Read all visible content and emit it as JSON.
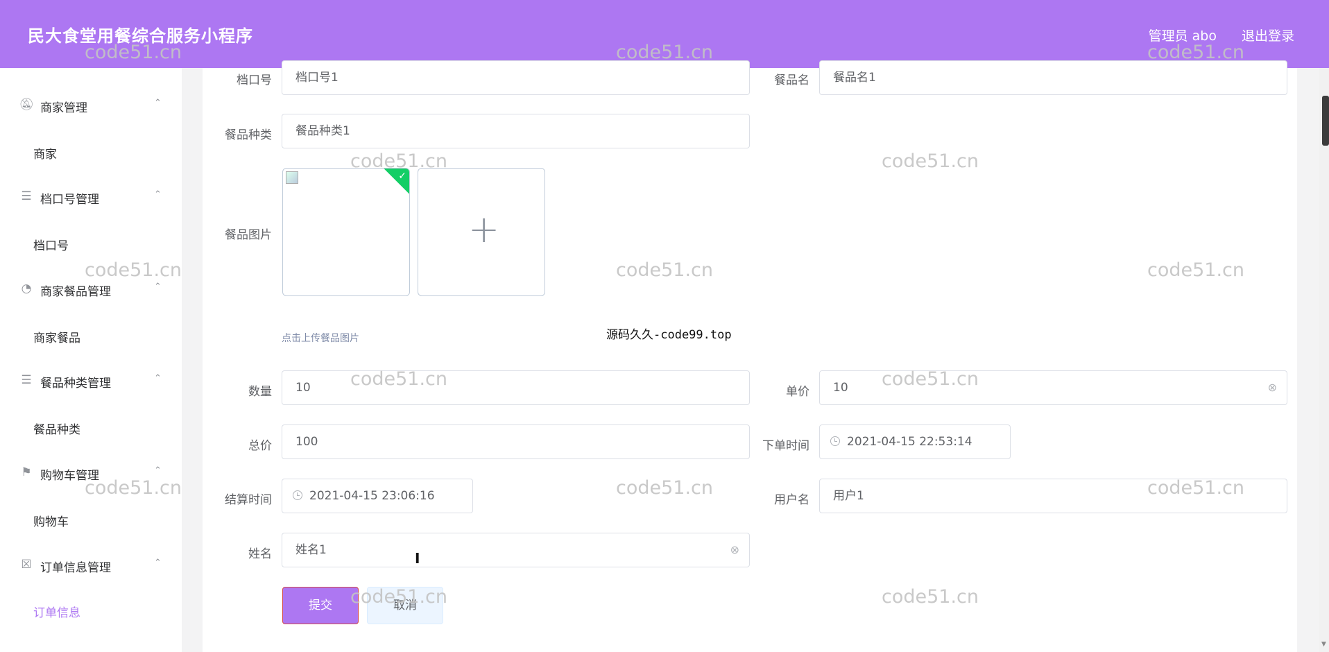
{
  "header": {
    "app_title": "民大食堂用餐综合服务小程序",
    "user_label": "管理员 abo",
    "logout_label": "退出登录"
  },
  "colors": {
    "accent": "#ad77f2",
    "success": "#13ce66",
    "border": "#dcdfe6"
  },
  "sidebar": {
    "groups": [
      {
        "icon": "bell-off-icon",
        "label": "商家管理",
        "items": [
          "商家"
        ]
      },
      {
        "icon": "list-icon",
        "label": "档口号管理",
        "items": [
          "档口号"
        ]
      },
      {
        "icon": "compass-icon",
        "label": "商家餐品管理",
        "items": [
          "商家餐品"
        ]
      },
      {
        "icon": "list-icon",
        "label": "餐品种类管理",
        "items": [
          "餐品种类"
        ]
      },
      {
        "icon": "flag-icon",
        "label": "购物车管理",
        "items": [
          "购物车"
        ]
      },
      {
        "icon": "clipboard-icon",
        "label": "订单信息管理",
        "items": [
          "订单信息"
        ]
      }
    ],
    "active_item": "订单信息"
  },
  "form": {
    "stall_label": "档口号",
    "stall_value": "档口号1",
    "dish_name_label": "餐品名",
    "dish_name_value": "餐品名1",
    "dish_type_label": "餐品种类",
    "dish_type_value": "餐品种类1",
    "dish_image_label": "餐品图片",
    "upload_tip": "点击上传餐品图片",
    "quantity_label": "数量",
    "quantity_value": "10",
    "unit_price_label": "单价",
    "unit_price_value": "10",
    "total_label": "总价",
    "total_value": "100",
    "order_time_label": "下单时间",
    "order_time_value": "2021-04-15 22:53:14",
    "settle_time_label": "结算时间",
    "settle_time_value": "2021-04-15 23:06:16",
    "username_label": "用户名",
    "username_value": "用户1",
    "name_label": "姓名",
    "name_value": "姓名1",
    "submit_label": "提交",
    "cancel_label": "取消"
  },
  "overlay": {
    "center_note": "源码久久-code99.top",
    "watermark": "code51.cn"
  }
}
